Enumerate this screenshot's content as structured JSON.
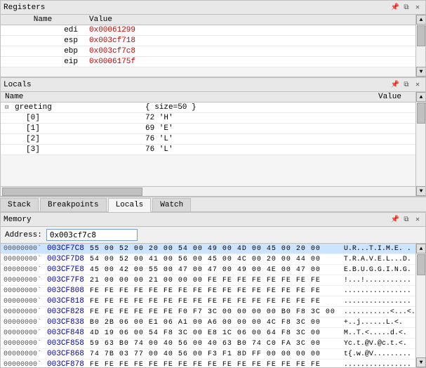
{
  "registers": {
    "title": "Registers",
    "columns": [
      "Name",
      "Value"
    ],
    "rows": [
      {
        "name": "edi",
        "value": "0x00061299",
        "color": "red"
      },
      {
        "name": "esp",
        "value": "0x003cf718",
        "color": "red"
      },
      {
        "name": "ebp",
        "value": "0x003cf7c8",
        "color": "red"
      },
      {
        "name": "eip",
        "value": "0x0006175f",
        "color": "red"
      }
    ]
  },
  "locals": {
    "title": "Locals",
    "columns": [
      "Name",
      "Value"
    ],
    "rows": [
      {
        "indent": 0,
        "expand": true,
        "name": "greeting",
        "value": "{ size=50 }"
      },
      {
        "indent": 1,
        "name": "[0]",
        "value": "72 'H'"
      },
      {
        "indent": 1,
        "name": "[1]",
        "value": "69 'E'"
      },
      {
        "indent": 1,
        "name": "[2]",
        "value": "76 'L'"
      },
      {
        "indent": 1,
        "name": "[3]",
        "value": "76 'L'"
      }
    ]
  },
  "tabs": [
    "Stack",
    "Breakpoints",
    "Locals",
    "Watch"
  ],
  "active_tab": "Locals",
  "memory": {
    "title": "Memory",
    "address_label": "Address:",
    "address_value": "0x003cf7c8",
    "rows": [
      {
        "addr1": "00000000`",
        "addr2": "003CF7C8",
        "hex": "55 00 52 00 20 00 54 00 49 00 4D 00 45 00 20 00",
        "ascii": "U.R...T.I.M.E. .",
        "highlight": true
      },
      {
        "addr1": "00000000`",
        "addr2": "003CF7D8",
        "hex": "54 00 52 00 41 00 56 00 45 00 4C 00 20 00 44 00",
        "ascii": "T.R.A.V.E.L...D.",
        "highlight": false
      },
      {
        "addr1": "00000000`",
        "addr2": "003CF7E8",
        "hex": "45 00 42 00 55 00 47 00 47 00 49 00 4E 00 47 00",
        "ascii": "E.B.U.G.G.I.N.G.",
        "highlight": false
      },
      {
        "addr1": "00000000`",
        "addr2": "003CF7F8",
        "hex": "21 00 00 00 21 00 00 00 FE FE FE FE FE FE FE FE",
        "ascii": "!...!...........",
        "highlight": false
      },
      {
        "addr1": "00000000`",
        "addr2": "003CF808",
        "hex": "FE FE FE FE FE FE FE FE FE FE FE FE FE FE FE FE",
        "ascii": "................",
        "highlight": false
      },
      {
        "addr1": "00000000`",
        "addr2": "003CF818",
        "hex": "FE FE FE FE FE FE FE FE FE FE FE FE FE FE FE FE",
        "ascii": "................",
        "highlight": false
      },
      {
        "addr1": "00000000`",
        "addr2": "003CF828",
        "hex": "FE FE FE FE FE FE F0 F7 3C 00 00 00 00 B0 F8 3C 00",
        "ascii": "...........<...<.",
        "highlight": false
      },
      {
        "addr1": "00000000`",
        "addr2": "003CF838",
        "hex": "B0 2B 06 00 E1 06 A1 00 A6 00 00 00 4C F8 3C 00",
        "ascii": "+..j......L.<.",
        "highlight": false
      },
      {
        "addr1": "00000000`",
        "addr2": "003CF848",
        "hex": "4D 19 06 00 54 F8 3C 00 E8 1C 06 00 64 F8 3C 00",
        "ascii": "M..T.<.....d.<.",
        "highlight": false
      },
      {
        "addr1": "00000000`",
        "addr2": "003CF858",
        "hex": "59 63 B0 74 00 40 56 00 40 63 B0 74 C0 FA 3C 00",
        "ascii": "Yc.t.@V.@c.t.<.",
        "highlight": false
      },
      {
        "addr1": "00000000`",
        "addr2": "003CF868",
        "hex": "74 7B 03 77 00 40 56 00 F3 F1 8D FF 00 00 00 00",
        "ascii": "t{.w.@V.........",
        "highlight": false
      },
      {
        "addr1": "00000000`",
        "addr2": "003CF878",
        "hex": "FE FE FE FE FE FE FE FE FE FE FE FE FE FE FE FE",
        "ascii": "................",
        "highlight": false
      }
    ]
  }
}
